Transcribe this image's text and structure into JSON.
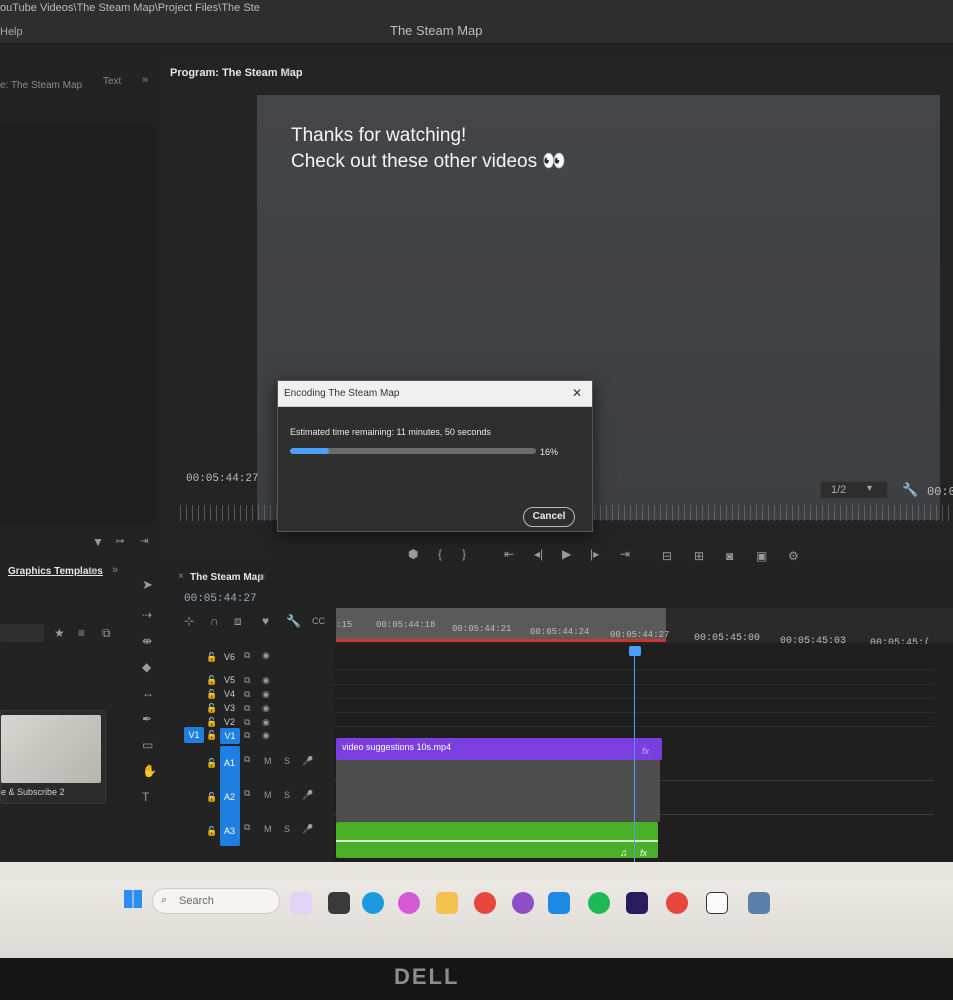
{
  "window": {
    "path": "ouTube Videos\\The Steam Map\\Project Files\\The Ste",
    "menu_help": "Help",
    "app_title": "The Steam Map"
  },
  "source_panel": {
    "tab_label": "e: The Steam Map",
    "text_tab": "Text",
    "overflow": "»"
  },
  "program": {
    "tab_label": "Program: The Steam Map",
    "menu_glyph": "≡",
    "line1": "Thanks for watching!",
    "line2": "Check out these other videos 👀",
    "timecode": "00:05:44:27",
    "zoom_select": "1/2",
    "timecode_right": "00:0"
  },
  "dialog": {
    "title": "Encoding The Steam Map",
    "close": "✕",
    "status": "Estimated time remaining: 11 minutes, 50 seconds",
    "progress_label": "16%",
    "progress": 0.16,
    "cancel": "Cancel"
  },
  "graphics_panel": {
    "tab_label": "Graphics Templates",
    "menu_glyph": "≡",
    "overflow": "»",
    "template_caption": "e & Subscribe 2"
  },
  "timeline": {
    "tab_label": "The Steam Map",
    "close": "×",
    "menu_glyph": "≡",
    "timecode": "00:05:44:27",
    "ruler": [
      ":15",
      "00:05:44:18",
      "00:05:44:21",
      "00:05:44:24",
      "00:05:44:27",
      "00:05:45:00",
      "00:05:45:03",
      "00:05:45:("
    ],
    "video_tracks": [
      "V6",
      "V5",
      "V4",
      "V3",
      "V2",
      "V1"
    ],
    "audio_tracks": [
      "A1",
      "A2",
      "A3"
    ],
    "source_patch": "V1",
    "mute": "M",
    "solo": "S",
    "clip_video": "video suggestions 10s.mp4",
    "fx": "fx",
    "music_note": "♫"
  },
  "taskbar": {
    "search_placeholder": "Search"
  },
  "monitor": {
    "brand": "DELL"
  },
  "colors": {
    "accent_blue": "#1f7fe0",
    "playhead": "#4a9fff",
    "video_clip": "#7b3fe0",
    "audio_clip": "#4caf2a",
    "in_out_range": "#cc3333"
  }
}
